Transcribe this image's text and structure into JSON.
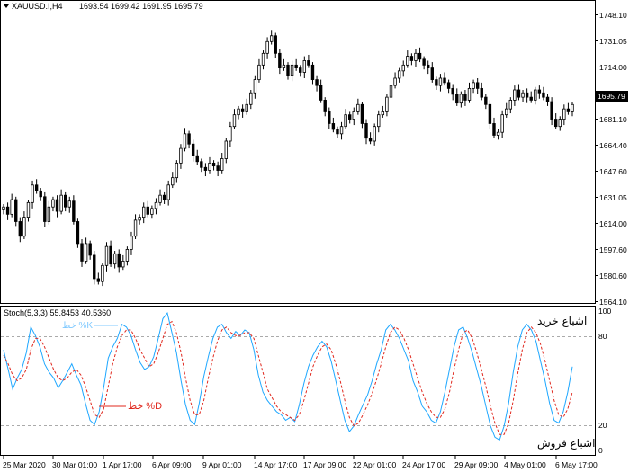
{
  "header": {
    "symbol": "XAUUSD.I,H4",
    "ohlc": "1693.54 1699.42 1691.95 1695.79"
  },
  "price_axis": {
    "ticks": [
      "1748.10",
      "1731.05",
      "1714.00",
      "1697.40",
      "1681.10",
      "1664.40",
      "1647.60",
      "1631.05",
      "1614.00",
      "1597.60",
      "1580.60",
      "1564.10"
    ],
    "current_price": "1695.79",
    "current_price_bg": "#000000"
  },
  "stoch": {
    "label": "Stoch(5,3,3) 55.8453 40.5360",
    "k_label": "خط %K",
    "d_label": "خط %D",
    "overbought_label": "اشباع خرید",
    "oversold_label": "اشباع فروش",
    "levels": [
      "100",
      "80",
      "20",
      "0"
    ],
    "k_color": "#1EA7FF",
    "d_color": "#E0281E"
  },
  "time_axis": {
    "ticks": [
      "25 Mar 2020",
      "30 Mar 01:00",
      "1 Apr 17:00",
      "6 Apr 09:00",
      "9 Apr 01:00",
      "14 Apr 17:00",
      "17 Apr 09:00",
      "22 Apr 01:00",
      "24 Apr 17:00",
      "29 Apr 09:00",
      "4 May 01:00",
      "6 May 17:00"
    ]
  },
  "chart_data": [
    {
      "type": "candlestick",
      "title": "XAUUSD.I,H4",
      "ylim": [
        1560,
        1756
      ],
      "y_ticks": [
        1748.1,
        1731.05,
        1714.0,
        1697.4,
        1681.1,
        1664.4,
        1647.6,
        1631.05,
        1614.0,
        1597.6,
        1580.6,
        1564.1
      ],
      "close_series": [
        1625,
        1620,
        1630,
        1615,
        1605,
        1618,
        1628,
        1640,
        1636,
        1632,
        1615,
        1625,
        1630,
        1622,
        1633,
        1625,
        1629,
        1615,
        1600,
        1588,
        1600,
        1592,
        1576,
        1574,
        1585,
        1598,
        1586,
        1593,
        1584,
        1588,
        1596,
        1605,
        1616,
        1618,
        1625,
        1620,
        1624,
        1628,
        1633,
        1630,
        1640,
        1645,
        1655,
        1665,
        1675,
        1668,
        1660,
        1656,
        1652,
        1650,
        1655,
        1653,
        1650,
        1658,
        1670,
        1680,
        1688,
        1692,
        1690,
        1695,
        1703,
        1712,
        1722,
        1730,
        1738,
        1742,
        1730,
        1720,
        1722,
        1715,
        1722,
        1720,
        1717,
        1725,
        1722,
        1712,
        1708,
        1698,
        1690,
        1682,
        1678,
        1675,
        1680,
        1688,
        1685,
        1690,
        1695,
        1682,
        1672,
        1670,
        1680,
        1688,
        1690,
        1700,
        1708,
        1713,
        1718,
        1722,
        1728,
        1725,
        1730,
        1726,
        1722,
        1720,
        1712,
        1708,
        1713,
        1710,
        1706,
        1702,
        1696,
        1702,
        1698,
        1706,
        1710,
        1706,
        1700,
        1695,
        1682,
        1674,
        1676,
        1688,
        1692,
        1698,
        1705,
        1700,
        1703,
        1700,
        1698,
        1705,
        1703,
        1700,
        1697,
        1685,
        1680,
        1685,
        1692,
        1690,
        1695
      ],
      "last_price": 1695.79
    },
    {
      "type": "line",
      "title": "Stoch(5,3,3) 55.8453 40.5360",
      "ylim": [
        0,
        100
      ],
      "levels": [
        20,
        80
      ],
      "series": [
        {
          "name": "%K",
          "values": [
            72,
            58,
            44,
            52,
            58,
            70,
            88,
            82,
            74,
            62,
            56,
            52,
            45,
            50,
            56,
            62,
            54,
            47,
            34,
            22,
            19,
            28,
            45,
            66,
            74,
            80,
            90,
            88,
            82,
            72,
            63,
            58,
            60,
            67,
            80,
            94,
            98,
            84,
            70,
            50,
            33,
            22,
            19,
            34,
            53,
            67,
            80,
            88,
            90,
            84,
            80,
            85,
            82,
            86,
            84,
            72,
            54,
            42,
            36,
            32,
            28,
            26,
            22,
            24,
            21,
            33,
            48,
            60,
            68,
            74,
            78,
            74,
            64,
            50,
            36,
            22,
            14,
            18,
            26,
            33,
            40,
            50,
            62,
            72,
            86,
            90,
            86,
            80,
            72,
            64,
            50,
            42,
            32,
            28,
            22,
            20,
            28,
            42,
            58,
            74,
            86,
            88,
            80,
            70,
            58,
            46,
            32,
            18,
            10,
            8,
            18,
            34,
            56,
            74,
            86,
            90,
            86,
            78,
            64,
            50,
            34,
            22,
            20,
            28,
            42,
            60
          ],
          "note": "%K"
        },
        {
          "name": "%D",
          "values": [
            68,
            62,
            54,
            50,
            52,
            58,
            72,
            80,
            80,
            74,
            66,
            58,
            52,
            50,
            52,
            56,
            58,
            54,
            46,
            36,
            26,
            24,
            30,
            46,
            62,
            74,
            82,
            86,
            86,
            80,
            72,
            66,
            60,
            62,
            70,
            80,
            90,
            92,
            84,
            70,
            52,
            36,
            26,
            26,
            36,
            52,
            66,
            78,
            86,
            88,
            84,
            82,
            82,
            84,
            84,
            80,
            68,
            56,
            44,
            38,
            32,
            28,
            26,
            24,
            22,
            26,
            36,
            48,
            60,
            68,
            74,
            76,
            72,
            62,
            50,
            36,
            24,
            18,
            20,
            26,
            33,
            41,
            51,
            62,
            74,
            84,
            88,
            86,
            80,
            72,
            62,
            52,
            42,
            34,
            28,
            24,
            24,
            30,
            42,
            58,
            72,
            84,
            86,
            80,
            70,
            58,
            46,
            32,
            20,
            12,
            12,
            20,
            36,
            55,
            72,
            84,
            88,
            84,
            76,
            64,
            50,
            36,
            26,
            24,
            30,
            42
          ]
        }
      ]
    }
  ]
}
